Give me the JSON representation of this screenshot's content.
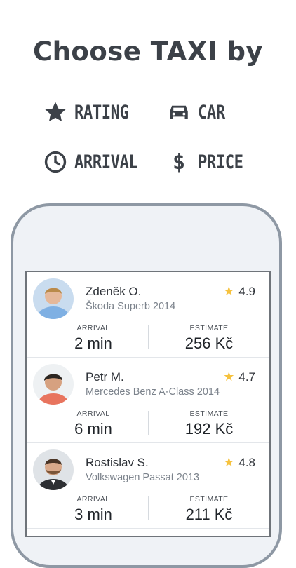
{
  "headline": "Choose TAXI by",
  "features": [
    {
      "icon": "star-icon",
      "label": "RATING"
    },
    {
      "icon": "car-icon",
      "label": "CAR"
    },
    {
      "icon": "clock-icon",
      "label": "ARRIVAL"
    },
    {
      "icon": "dollar-icon",
      "label": "PRICE"
    }
  ],
  "labels": {
    "arrival": "ARRIVAL",
    "estimate": "ESTIMATE"
  },
  "drivers": [
    {
      "name": "Zdeněk O.",
      "car": "Škoda Superb 2014",
      "rating": "4.9",
      "arrival": "2 min",
      "estimate": "256 Kč"
    },
    {
      "name": "Petr M.",
      "car": "Mercedes Benz A-Class 2014",
      "rating": "4.7",
      "arrival": "6 min",
      "estimate": "192 Kč"
    },
    {
      "name": "Rostislav S.",
      "car": "Volkswagen Passat 2013",
      "rating": "4.8",
      "arrival": "3 min",
      "estimate": "211 Kč"
    }
  ],
  "colors": {
    "text": "#3c4148",
    "star": "#f6c23e",
    "phone_frame": "#8e98a4"
  }
}
